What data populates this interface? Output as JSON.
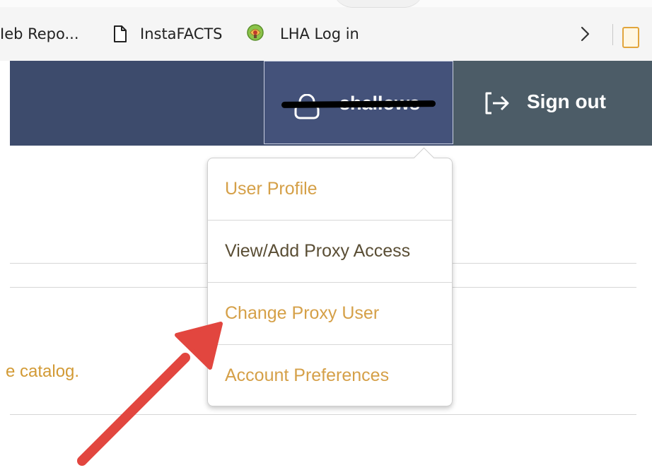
{
  "bookmarks": [
    {
      "label": "Ieb Repo...",
      "icon": "none"
    },
    {
      "label": "InstaFACTS",
      "icon": "page-icon"
    },
    {
      "label": "LHA Log in",
      "icon": "lha-globe-icon"
    }
  ],
  "header": {
    "username": "shallows",
    "signout_label": "Sign out"
  },
  "content": {
    "catalog_text": "e catalog."
  },
  "user_menu": {
    "items": [
      {
        "label": "User Profile"
      },
      {
        "label": "View/Add Proxy Access"
      },
      {
        "label": "Change Proxy User"
      },
      {
        "label": "Account Preferences"
      }
    ]
  },
  "colors": {
    "header_bg": "#3d4b6c",
    "signout_bg": "#4c5c67",
    "accent_orange": "#d5a048",
    "annotation_red": "#e2463f"
  }
}
